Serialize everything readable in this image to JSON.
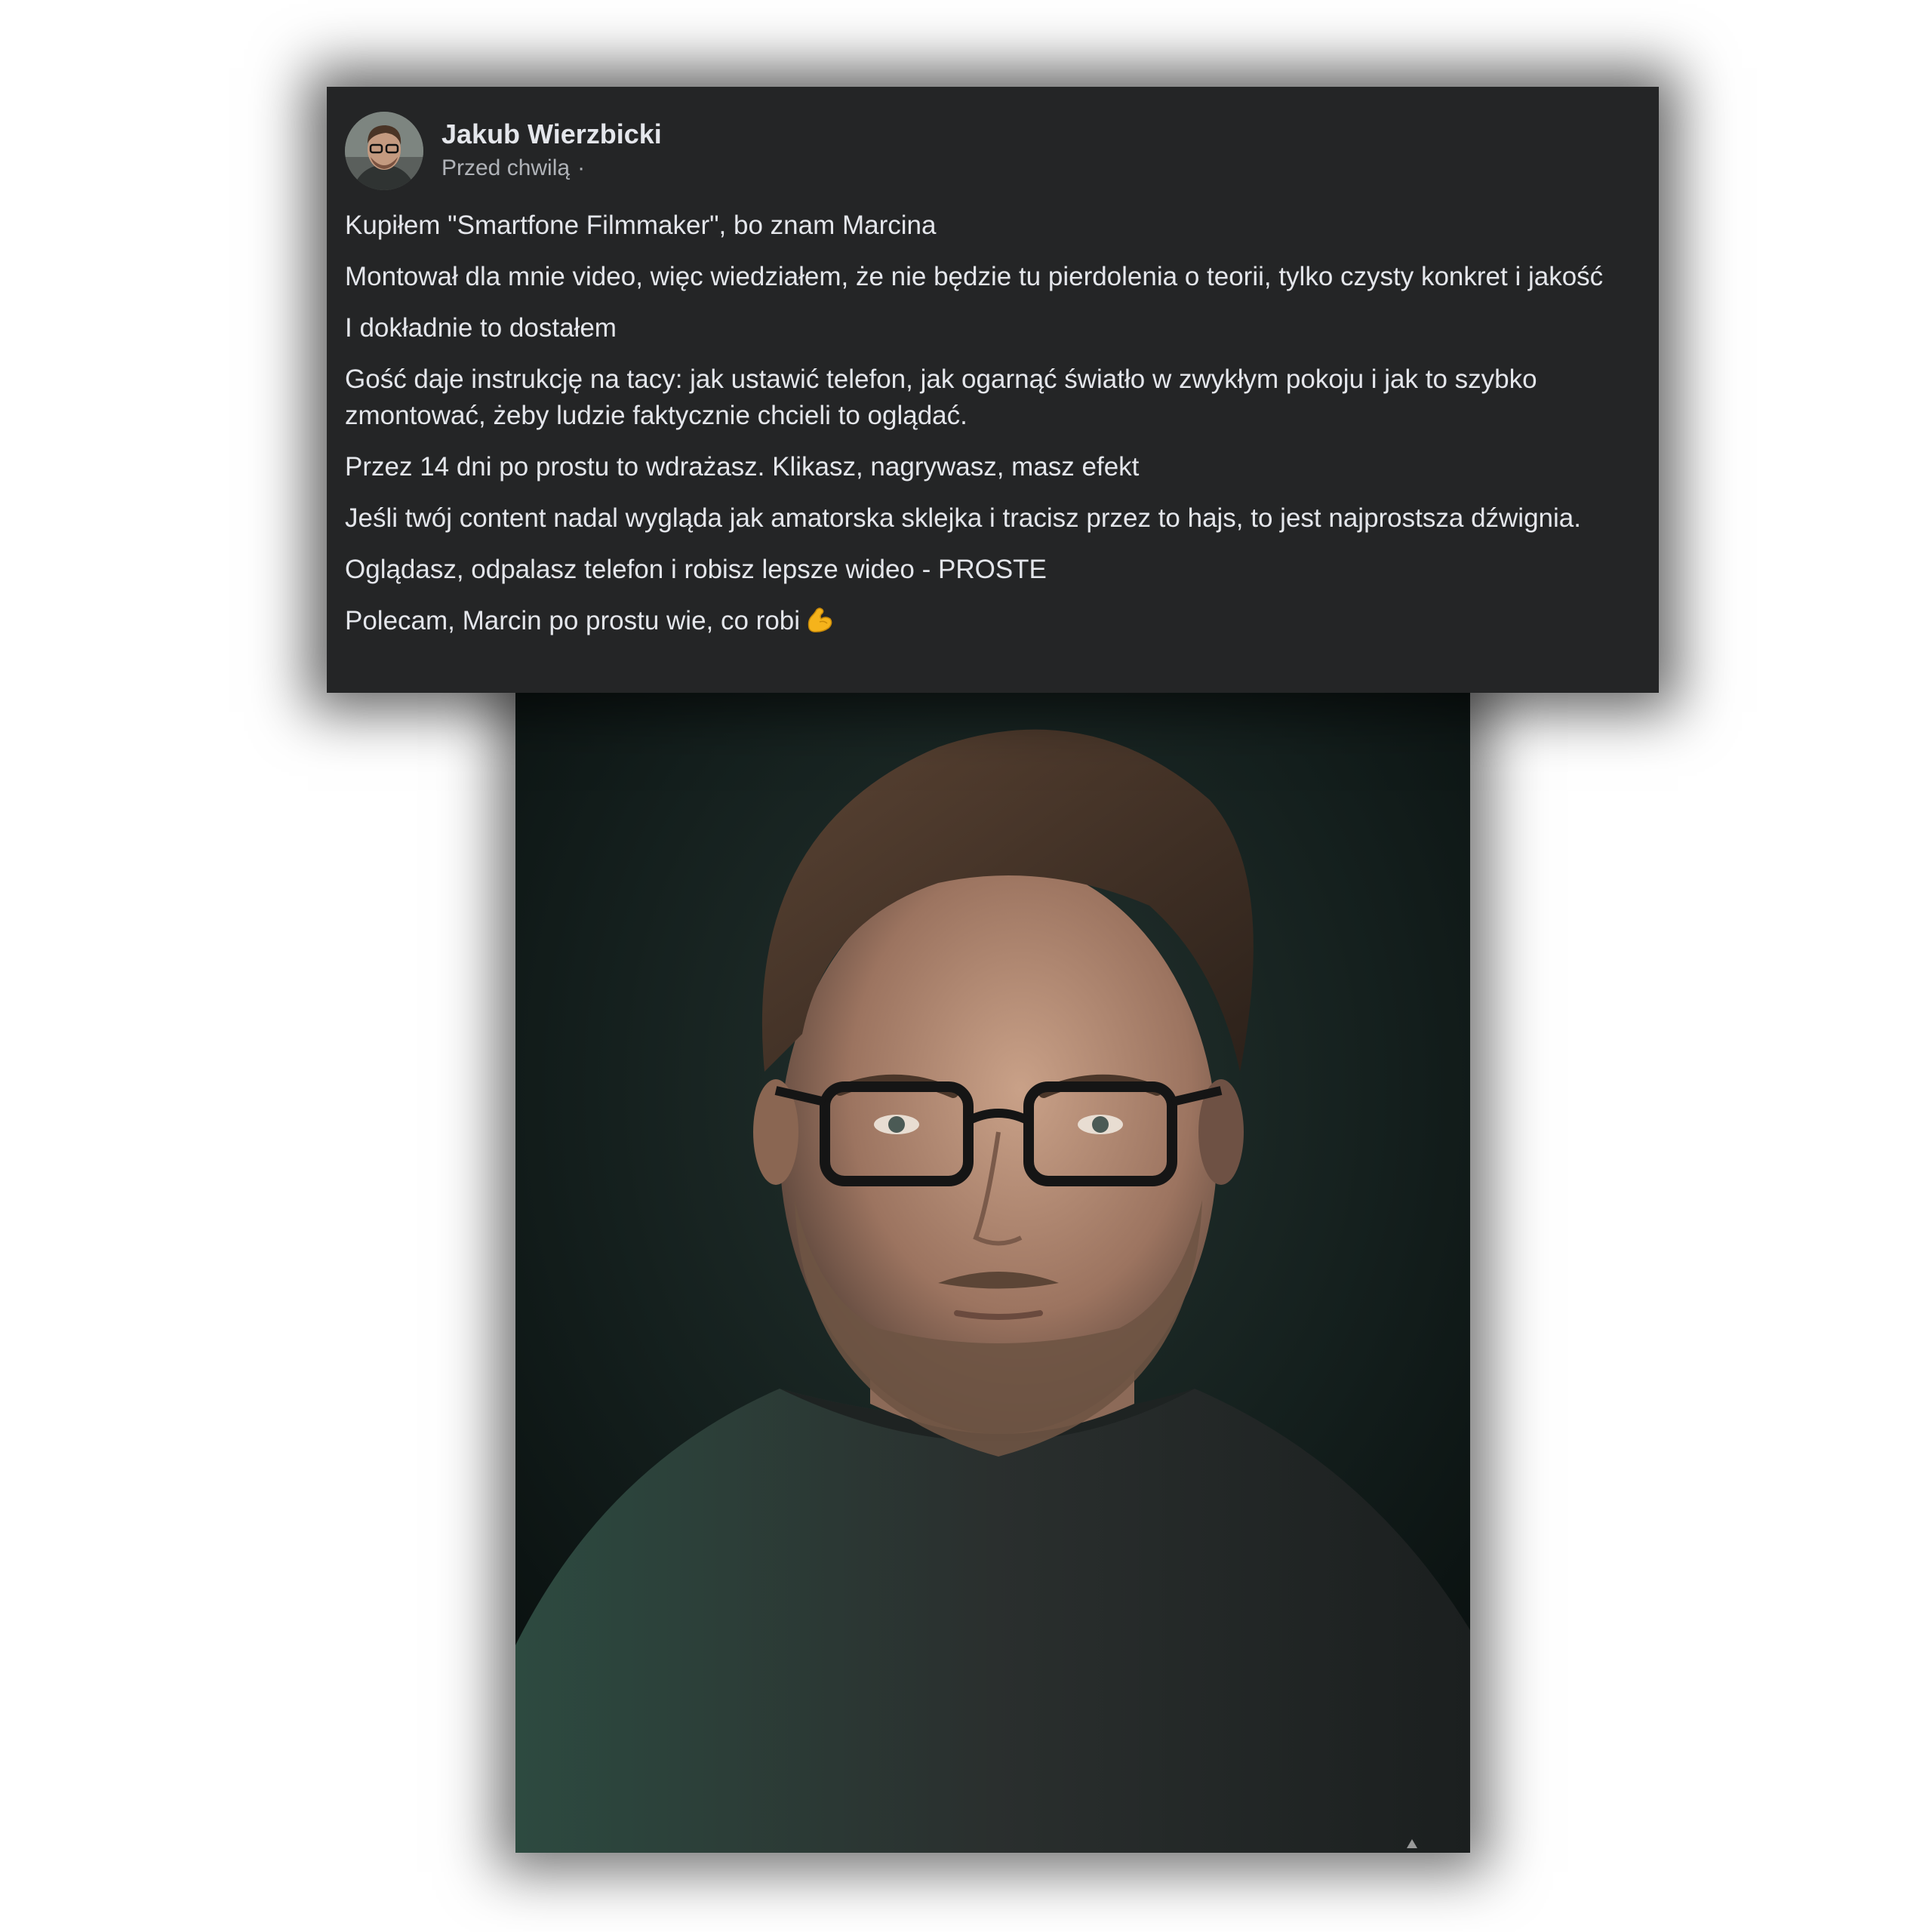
{
  "post": {
    "author": "Jakub Wierzbicki",
    "time": "Przed chwilą",
    "meta_separator": "·",
    "avatar_icon": "profile-photo",
    "paragraphs": [
      "Kupiłem \"Smartfone Filmmaker\", bo znam Marcina",
      "Montował dla mnie video, więc wiedziałem, że nie będzie tu pierdolenia o teorii, tylko czysty konkret i jakość",
      "I dokładnie to dostałem",
      "Gość daje instrukcję na tacy: jak ustawić telefon, jak ogarnąć światło w zwykłym pokoju i jak to szybko zmontować, żeby ludzie faktycznie chcieli to oglądać.",
      "Przez 14 dni po prostu to wdrażasz. Klikasz, nagrywasz, masz efekt",
      "Jeśli twój content nadal wygląda jak amatorska sklejka i tracisz przez to hajs, to jest najprostsza dźwignia.",
      "Oglądasz, odpalasz telefon i robisz lepsze wideo - PROSTE"
    ],
    "last_paragraph": "Polecam, Marcin po prostu wie, co robi",
    "last_emoji": "flexed-biceps-icon"
  },
  "photo": {
    "subject": "portrait-photo",
    "background_color": "#14201e"
  },
  "colors": {
    "card_bg": "#242526",
    "text_primary": "#e4e6eb",
    "text_secondary": "#b0b3b8",
    "page_bg": "#ffffff"
  }
}
